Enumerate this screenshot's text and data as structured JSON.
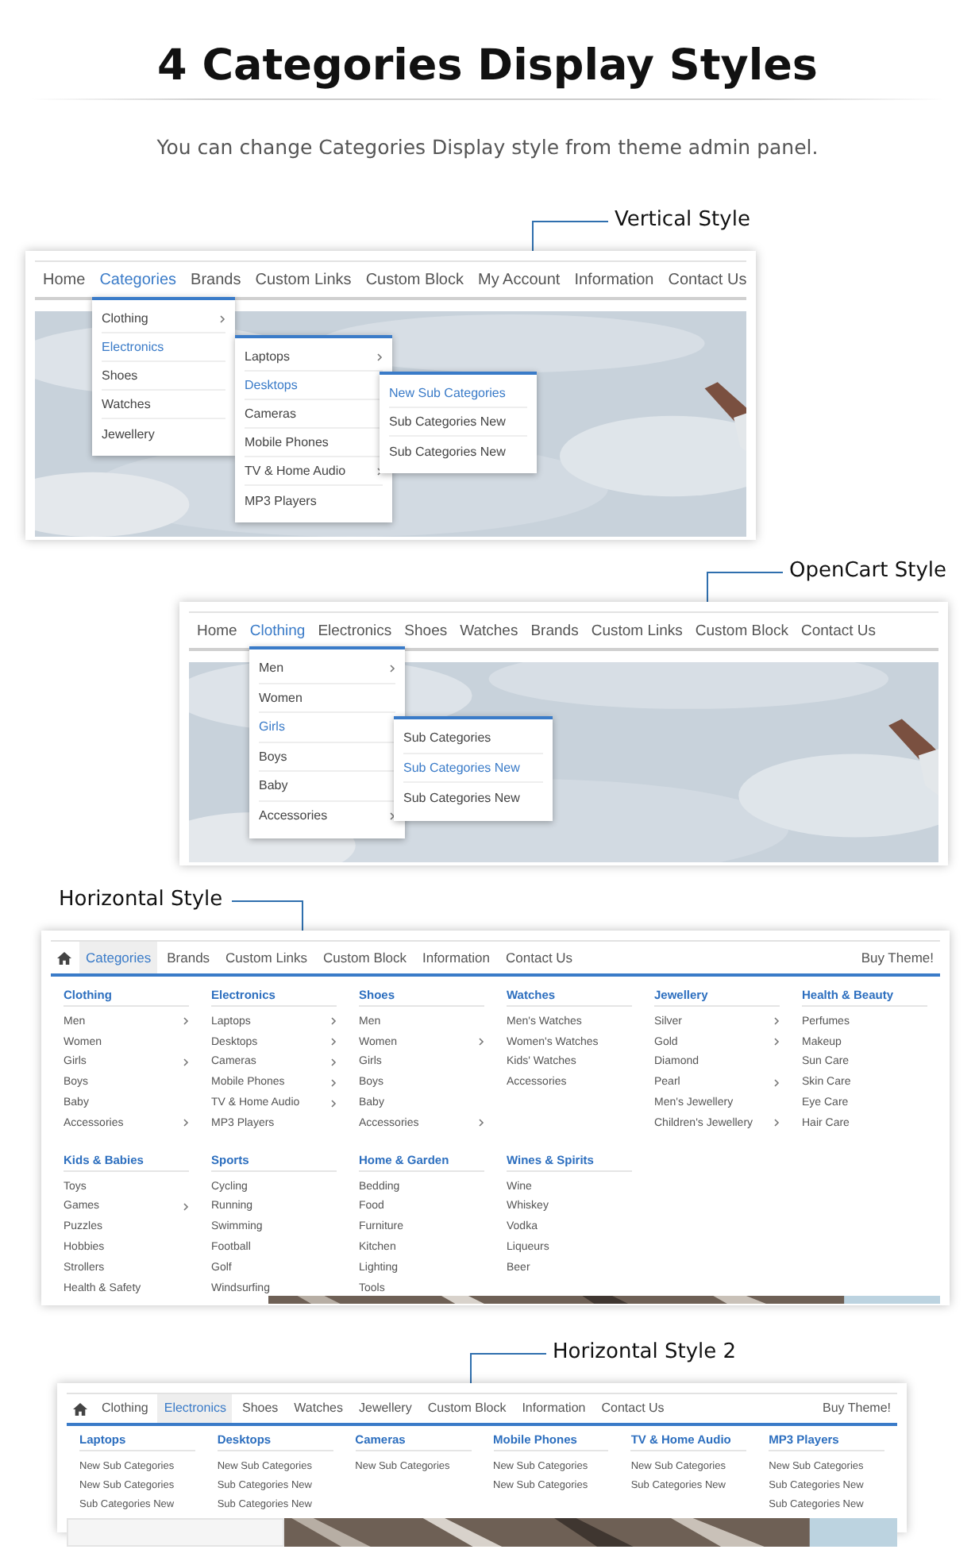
{
  "title": "4 Categories Display Styles",
  "subtitle": "You can change Categories Display style from theme admin panel.",
  "sections": [
    {
      "kind": "vertical",
      "label": "Vertical Style",
      "nav": [
        {
          "label": "Home",
          "selected": false
        },
        {
          "label": "Categories",
          "selected": true
        },
        {
          "label": "Brands",
          "selected": false
        },
        {
          "label": "Custom Links",
          "selected": false
        },
        {
          "label": "Custom Block",
          "selected": false
        },
        {
          "label": "My Account",
          "selected": false
        },
        {
          "label": "Information",
          "selected": false
        },
        {
          "label": "Contact Us",
          "selected": false
        }
      ],
      "menus": [
        {
          "items": [
            {
              "label": "Clothing",
              "selected": false,
              "arrow": true
            },
            {
              "label": "Electronics",
              "selected": true,
              "arrow": false
            },
            {
              "label": "Shoes",
              "selected": false,
              "arrow": false
            },
            {
              "label": "Watches",
              "selected": false,
              "arrow": false
            },
            {
              "label": "Jewellery",
              "selected": false,
              "arrow": false
            }
          ]
        },
        {
          "items": [
            {
              "label": "Laptops",
              "selected": false,
              "arrow": true
            },
            {
              "label": "Desktops",
              "selected": true,
              "arrow": false
            },
            {
              "label": "Cameras",
              "selected": false,
              "arrow": false
            },
            {
              "label": "Mobile Phones",
              "selected": false,
              "arrow": false
            },
            {
              "label": "TV & Home Audio",
              "selected": false,
              "arrow": true
            },
            {
              "label": "MP3 Players",
              "selected": false,
              "arrow": false
            }
          ]
        },
        {
          "items": [
            {
              "label": "New Sub Categories",
              "selected": true,
              "arrow": false
            },
            {
              "label": "Sub Categories New",
              "selected": false,
              "arrow": false
            },
            {
              "label": "Sub Categories New",
              "selected": false,
              "arrow": false
            }
          ]
        }
      ]
    },
    {
      "kind": "opencart",
      "label": "OpenCart Style",
      "nav": [
        {
          "label": "Home",
          "selected": false
        },
        {
          "label": "Clothing",
          "selected": true
        },
        {
          "label": "Electronics",
          "selected": false
        },
        {
          "label": "Shoes",
          "selected": false
        },
        {
          "label": "Watches",
          "selected": false
        },
        {
          "label": "Brands",
          "selected": false
        },
        {
          "label": "Custom Links",
          "selected": false
        },
        {
          "label": "Custom Block",
          "selected": false
        },
        {
          "label": "Contact Us",
          "selected": false
        }
      ],
      "menus": [
        {
          "items": [
            {
              "label": "Men",
              "selected": false,
              "arrow": true
            },
            {
              "label": "Women",
              "selected": false,
              "arrow": false
            },
            {
              "label": "Girls",
              "selected": true,
              "arrow": false
            },
            {
              "label": "Boys",
              "selected": false,
              "arrow": false
            },
            {
              "label": "Baby",
              "selected": false,
              "arrow": false
            },
            {
              "label": "Accessories",
              "selected": false,
              "arrow": true
            }
          ]
        },
        {
          "items": [
            {
              "label": "Sub Categories",
              "selected": false,
              "arrow": false
            },
            {
              "label": "Sub Categories New",
              "selected": true,
              "arrow": false
            },
            {
              "label": "Sub Categories New",
              "selected": false,
              "arrow": false
            }
          ]
        }
      ]
    },
    {
      "kind": "horizontal",
      "label": "Horizontal Style",
      "buy": "Buy Theme!",
      "nav": [
        {
          "label": "Categories",
          "selected": true
        },
        {
          "label": "Brands",
          "selected": false
        },
        {
          "label": "Custom Links",
          "selected": false
        },
        {
          "label": "Custom Block",
          "selected": false
        },
        {
          "label": "Information",
          "selected": false
        },
        {
          "label": "Contact Us",
          "selected": false
        }
      ],
      "groups": [
        {
          "heading": "Clothing",
          "items": [
            {
              "label": "Men",
              "arrow": true
            },
            {
              "label": "Women",
              "arrow": false
            },
            {
              "label": "Girls",
              "arrow": true
            },
            {
              "label": "Boys",
              "arrow": false
            },
            {
              "label": "Baby",
              "arrow": false
            },
            {
              "label": "Accessories",
              "arrow": true
            }
          ]
        },
        {
          "heading": "Electronics",
          "items": [
            {
              "label": "Laptops",
              "arrow": true
            },
            {
              "label": "Desktops",
              "arrow": true
            },
            {
              "label": "Cameras",
              "arrow": true
            },
            {
              "label": "Mobile Phones",
              "arrow": true
            },
            {
              "label": "TV & Home Audio",
              "arrow": true
            },
            {
              "label": "MP3 Players",
              "arrow": false
            }
          ]
        },
        {
          "heading": "Shoes",
          "items": [
            {
              "label": "Men",
              "arrow": false
            },
            {
              "label": "Women",
              "arrow": true
            },
            {
              "label": "Girls",
              "arrow": false
            },
            {
              "label": "Boys",
              "arrow": false
            },
            {
              "label": "Baby",
              "arrow": false
            },
            {
              "label": "Accessories",
              "arrow": true
            }
          ]
        },
        {
          "heading": "Watches",
          "items": [
            {
              "label": "Men's Watches",
              "arrow": false
            },
            {
              "label": "Women's Watches",
              "arrow": false
            },
            {
              "label": "Kids' Watches",
              "arrow": false
            },
            {
              "label": "Accessories",
              "arrow": false
            }
          ]
        },
        {
          "heading": "Jewellery",
          "items": [
            {
              "label": "Silver",
              "arrow": true
            },
            {
              "label": "Gold",
              "arrow": true
            },
            {
              "label": "Diamond",
              "arrow": false
            },
            {
              "label": "Pearl",
              "arrow": true
            },
            {
              "label": "Men's Jewellery",
              "arrow": false
            },
            {
              "label": "Children's Jewellery",
              "arrow": true
            }
          ]
        },
        {
          "heading": "Health & Beauty",
          "items": [
            {
              "label": "Perfumes",
              "arrow": false
            },
            {
              "label": "Makeup",
              "arrow": false
            },
            {
              "label": "Sun Care",
              "arrow": false
            },
            {
              "label": "Skin Care",
              "arrow": false
            },
            {
              "label": "Eye Care",
              "arrow": false
            },
            {
              "label": "Hair Care",
              "arrow": false
            }
          ]
        },
        {
          "heading": "Kids & Babies",
          "items": [
            {
              "label": "Toys",
              "arrow": false
            },
            {
              "label": "Games",
              "arrow": true
            },
            {
              "label": "Puzzles",
              "arrow": false
            },
            {
              "label": "Hobbies",
              "arrow": false
            },
            {
              "label": "Strollers",
              "arrow": false
            },
            {
              "label": "Health & Safety",
              "arrow": false
            }
          ]
        },
        {
          "heading": "Sports",
          "items": [
            {
              "label": "Cycling",
              "arrow": false
            },
            {
              "label": "Running",
              "arrow": false
            },
            {
              "label": "Swimming",
              "arrow": false
            },
            {
              "label": "Football",
              "arrow": false
            },
            {
              "label": "Golf",
              "arrow": false
            },
            {
              "label": "Windsurfing",
              "arrow": false
            }
          ]
        },
        {
          "heading": "Home & Garden",
          "items": [
            {
              "label": "Bedding",
              "arrow": false
            },
            {
              "label": "Food",
              "arrow": false
            },
            {
              "label": "Furniture",
              "arrow": false
            },
            {
              "label": "Kitchen",
              "arrow": false
            },
            {
              "label": "Lighting",
              "arrow": false
            },
            {
              "label": "Tools",
              "arrow": false
            }
          ]
        },
        {
          "heading": "Wines & Spirits",
          "items": [
            {
              "label": "Wine",
              "arrow": false
            },
            {
              "label": "Whiskey",
              "arrow": false
            },
            {
              "label": "Vodka",
              "arrow": false
            },
            {
              "label": "Liqueurs",
              "arrow": false
            },
            {
              "label": "Beer",
              "arrow": false
            }
          ]
        }
      ]
    },
    {
      "kind": "horizontal2",
      "label": "Horizontal Style 2",
      "buy": "Buy Theme!",
      "nav": [
        {
          "label": "Clothing",
          "selected": false
        },
        {
          "label": "Electronics",
          "selected": true
        },
        {
          "label": "Shoes",
          "selected": false
        },
        {
          "label": "Watches",
          "selected": false
        },
        {
          "label": "Jewellery",
          "selected": false
        },
        {
          "label": "Custom Block",
          "selected": false
        },
        {
          "label": "Information",
          "selected": false
        },
        {
          "label": "Contact Us",
          "selected": false
        }
      ],
      "groups": [
        {
          "heading": "Laptops",
          "items": [
            {
              "label": "New Sub Categories",
              "arrow": false
            },
            {
              "label": "New Sub Categories",
              "arrow": false
            },
            {
              "label": "Sub Categories New",
              "arrow": false
            }
          ]
        },
        {
          "heading": "Desktops",
          "items": [
            {
              "label": "New Sub Categories",
              "arrow": false
            },
            {
              "label": "Sub Categories New",
              "arrow": false
            },
            {
              "label": "Sub Categories New",
              "arrow": false
            }
          ]
        },
        {
          "heading": "Cameras",
          "items": [
            {
              "label": "New Sub Categories",
              "arrow": false
            }
          ]
        },
        {
          "heading": "Mobile Phones",
          "items": [
            {
              "label": "New Sub Categories",
              "arrow": false
            },
            {
              "label": "New Sub Categories",
              "arrow": false
            }
          ]
        },
        {
          "heading": "TV & Home Audio",
          "items": [
            {
              "label": "New Sub Categories",
              "arrow": false
            },
            {
              "label": "Sub Categories New",
              "arrow": false
            }
          ]
        },
        {
          "heading": "MP3 Players",
          "items": [
            {
              "label": "New Sub Categories",
              "arrow": false
            },
            {
              "label": "Sub Categories New",
              "arrow": false
            },
            {
              "label": "Sub Categories New",
              "arrow": false
            }
          ]
        }
      ]
    }
  ]
}
